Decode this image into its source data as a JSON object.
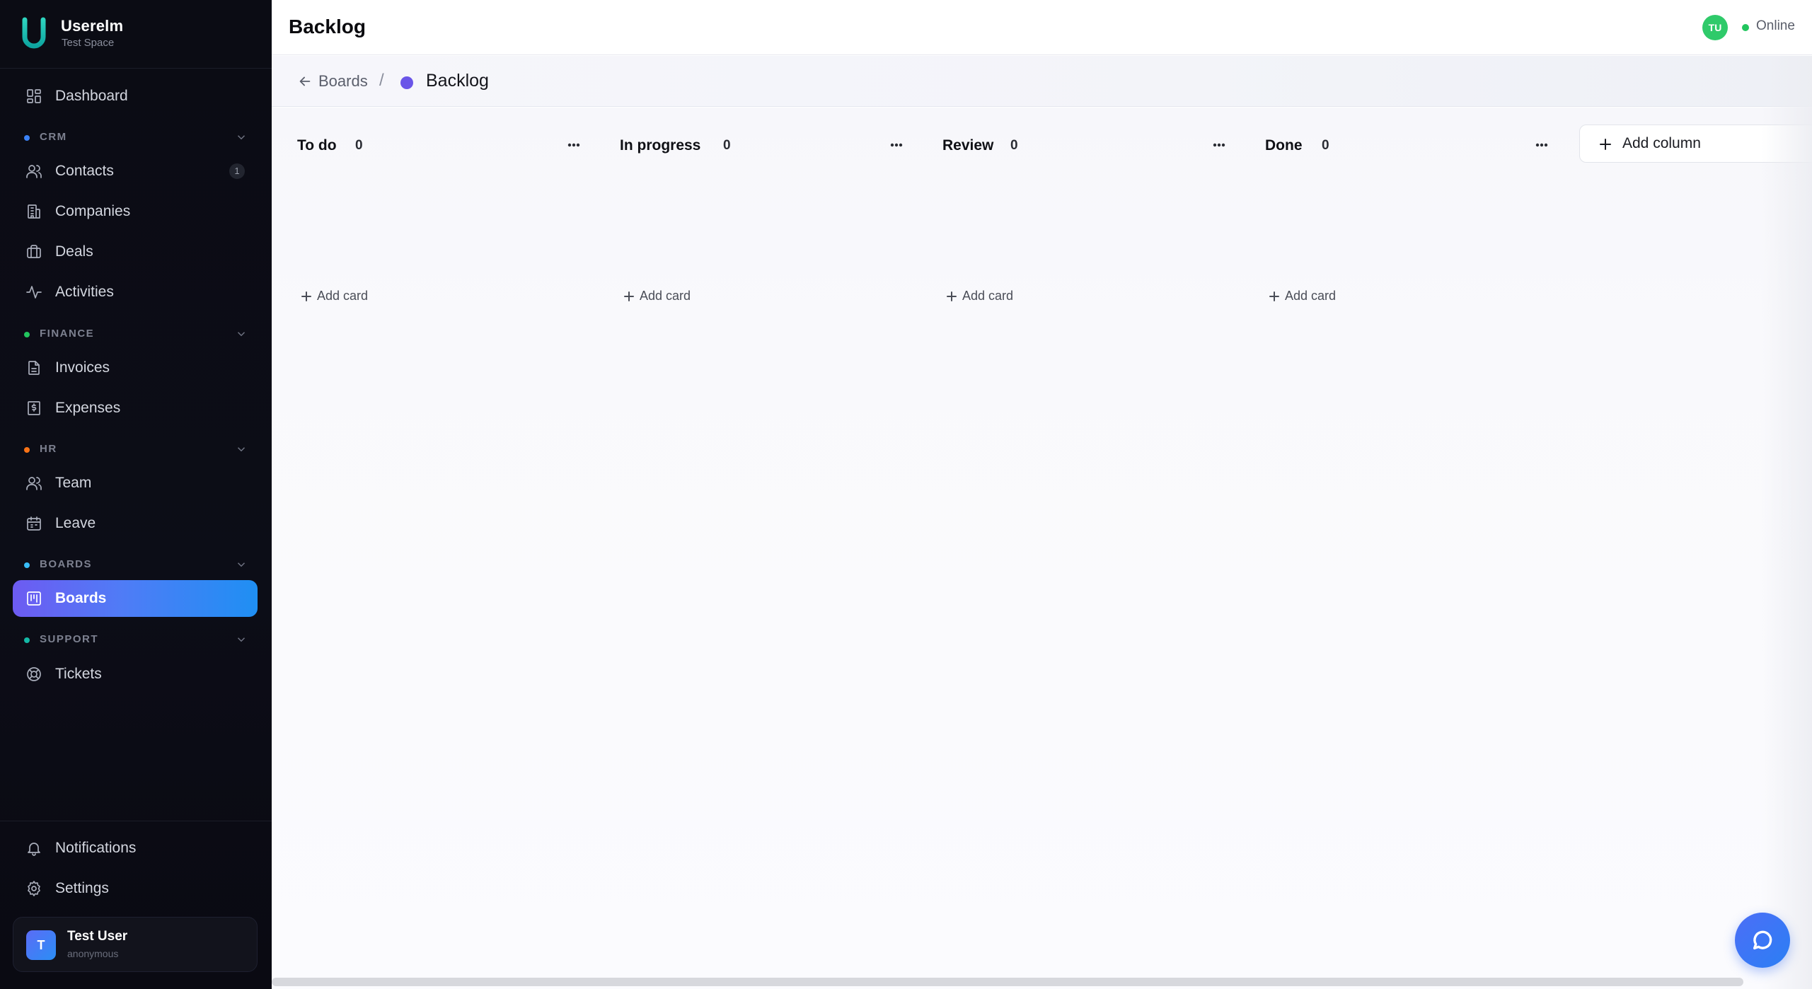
{
  "brand": {
    "name": "Userelm",
    "subtitle": "Test Space",
    "accent": "#1fb6a6"
  },
  "sidebar": {
    "dashboard": {
      "label": "Dashboard",
      "icon": "dashboard-icon"
    },
    "sections": {
      "crm": {
        "title": "CRM",
        "dot_color": "#3b82f6"
      },
      "finance": {
        "title": "FINANCE",
        "dot_color": "#22c55e"
      },
      "hr": {
        "title": "HR",
        "dot_color": "#f97316"
      },
      "boards": {
        "title": "BOARDS",
        "dot_color": "#38bdf8"
      },
      "support": {
        "title": "SUPPORT",
        "dot_color": "#14b8a6"
      }
    },
    "items": {
      "contacts": {
        "label": "Contacts",
        "badge": "1",
        "icon": "users-icon"
      },
      "companies": {
        "label": "Companies",
        "icon": "building-icon"
      },
      "deals": {
        "label": "Deals",
        "icon": "briefcase-icon"
      },
      "activities": {
        "label": "Activities",
        "icon": "activity-icon"
      },
      "invoices": {
        "label": "Invoices",
        "icon": "file-icon"
      },
      "expenses": {
        "label": "Expenses",
        "icon": "receipt-icon"
      },
      "team": {
        "label": "Team",
        "icon": "users-icon"
      },
      "leave": {
        "label": "Leave",
        "icon": "calendar-icon"
      },
      "boards": {
        "label": "Boards",
        "icon": "kanban-icon",
        "active": true
      },
      "tickets": {
        "label": "Tickets",
        "icon": "lifebuoy-icon"
      }
    },
    "footer": {
      "notifications": {
        "label": "Notifications",
        "icon": "bell-icon"
      },
      "settings": {
        "label": "Settings",
        "icon": "gear-icon"
      }
    },
    "user": {
      "initial": "T",
      "name": "Test User",
      "subtitle": "anonymous"
    }
  },
  "header": {
    "title": "Backlog",
    "avatar_initials": "TU",
    "status": "Online",
    "status_color": "#22c55e"
  },
  "breadcrumb": {
    "parent": "Boards",
    "separator": "/",
    "current": "Backlog",
    "dot_color": "#6a55e8"
  },
  "board": {
    "columns": [
      {
        "title": "To do",
        "count": "0",
        "add_label": "Add card"
      },
      {
        "title": "In progress",
        "count": "0",
        "add_label": "Add card"
      },
      {
        "title": "Review",
        "count": "0",
        "add_label": "Add card"
      },
      {
        "title": "Done",
        "count": "0",
        "add_label": "Add card"
      }
    ],
    "add_column_label": "Add column"
  }
}
